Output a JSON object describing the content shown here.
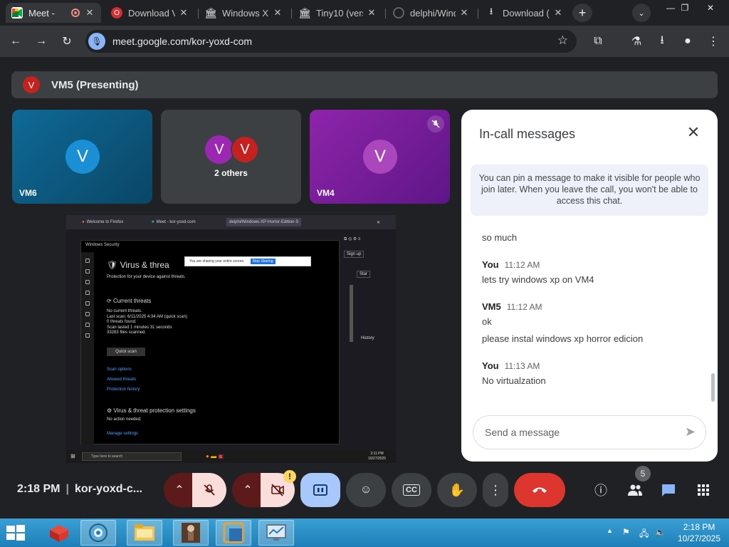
{
  "browser": {
    "tabs": [
      {
        "label": "Meet - ",
        "active": true,
        "icon": "meet-icon"
      },
      {
        "label": "Download V",
        "active": false,
        "icon": "opera-icon"
      },
      {
        "label": "Windows X",
        "active": false,
        "icon": "archive-icon"
      },
      {
        "label": "Tiny10 (vers",
        "active": false,
        "icon": "archive-icon"
      },
      {
        "label": "delphi/Wind",
        "active": false,
        "icon": "github-icon"
      },
      {
        "label": "Download (",
        "active": false,
        "icon": "download-icon"
      }
    ],
    "new_tab_label": "+",
    "url": "meet.google.com/kor-yoxd-com"
  },
  "meet": {
    "presenting_avatar": "V",
    "presenting_label": "VM5 (Presenting)",
    "tiles": [
      {
        "name": "VM6",
        "avatar": "V"
      },
      {
        "name": "2 others",
        "avatars": [
          "V",
          "V"
        ]
      },
      {
        "name": "VM4",
        "avatar": "V",
        "muted": true
      }
    ],
    "meeting_time": "2:18 PM",
    "meeting_code": "kor-yoxd-c...",
    "people_count": "5"
  },
  "shared_screen": {
    "tabs": [
      "Welcome to Firefox",
      "Meet - kor-yoxd-com",
      "delphi/Windows-XP-Horror-Edition-S"
    ],
    "window_title": "Windows Security",
    "share_notice": "You are sharing your entire screen.",
    "stop_sharing": "Stop Sharing",
    "heading": "Virus & threa",
    "subheading": "Protection for your device against threats.",
    "current_threats_title": "Current threats",
    "threat_lines": [
      "No current threats.",
      "Last scan: 6/11/2025 4:34 AM (quick scan)",
      "0 threats found.",
      "Scan lasted 1 minutes 31 seconds",
      "33283 files scanned."
    ],
    "quick_scan": "Quick scan",
    "links": [
      "Scan options",
      "Allowed threats",
      "Protection history"
    ],
    "settings_title": "Virus & threat protection settings",
    "settings_status": "No action needed.",
    "manage_settings": "Manage settings",
    "search_placeholder": "Type here to search",
    "sign_up": "Sign up",
    "star_label": "Star",
    "history_label": "History",
    "clock_time": "2:11 PM",
    "clock_date": "10/27/2025"
  },
  "chat": {
    "title": "In-call messages",
    "pin_note": "You can pin a message to make it visible for people who join later. When you leave the call, you won't be able to access this chat.",
    "first_text": "so much",
    "groups": [
      {
        "sender": "You",
        "time": "11:12 AM",
        "texts": [
          "lets try windows xp on VM4"
        ]
      },
      {
        "sender": "VM5",
        "time": "11:12 AM",
        "texts": [
          "ok",
          "please instal windows xp horror edicion"
        ]
      },
      {
        "sender": "You",
        "time": "11:13 AM",
        "texts": [
          "No virtualzation"
        ]
      }
    ],
    "input_placeholder": "Send a message"
  },
  "taskbar": {
    "time": "2:18 PM",
    "date": "10/27/2025"
  },
  "colors": {
    "meet_bg": "#202124",
    "accent_blue": "#8ab4f8",
    "end_call_red": "#dc362e",
    "tile_vm6": "#0b5a82",
    "tile_vm4": "#7b1fa2"
  }
}
